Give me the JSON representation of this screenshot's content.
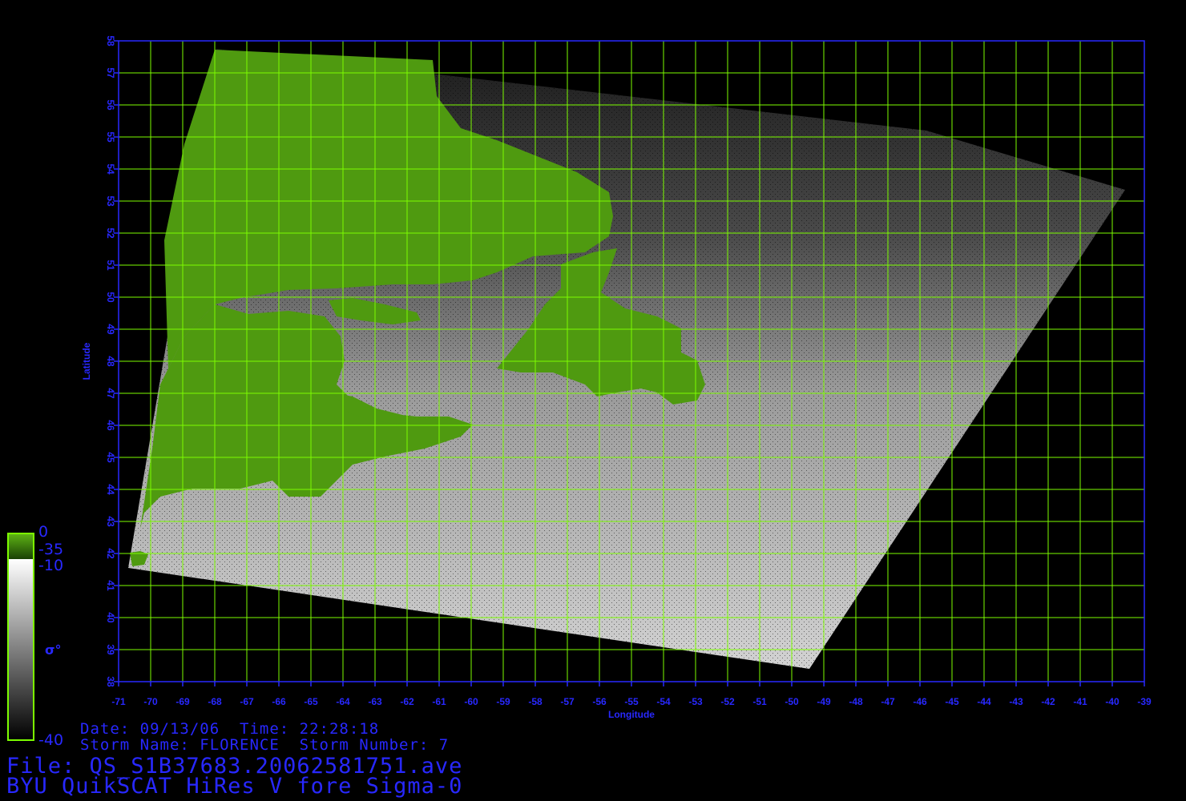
{
  "colors": {
    "axis": "#2828ff",
    "grid": "#7cfc00",
    "land": "#4f9a10",
    "text": "#2828ff",
    "background": "#000000"
  },
  "map": {
    "x_axis": {
      "label": "Longitude",
      "min": -71,
      "max": -39,
      "ticks": [
        -71,
        -70,
        -69,
        -68,
        -67,
        -66,
        -65,
        -64,
        -63,
        -62,
        -61,
        -60,
        -59,
        -58,
        -57,
        -56,
        -55,
        -54,
        -53,
        -52,
        -51,
        -50,
        -49,
        -48,
        -47,
        -46,
        -45,
        -44,
        -43,
        -42,
        -41,
        -40,
        -39
      ]
    },
    "y_axis": {
      "label": "Latitude",
      "min": 38,
      "max": 58,
      "ticks": [
        38,
        39,
        40,
        41,
        42,
        43,
        44,
        45,
        46,
        47,
        48,
        49,
        50,
        51,
        52,
        53,
        54,
        55,
        56,
        57,
        58
      ]
    },
    "swath_corners_lonlat": [
      [
        -67.95,
        57.75
      ],
      [
        -45.8,
        55.2
      ],
      [
        -39.6,
        53.35
      ],
      [
        -49.45,
        38.4
      ],
      [
        -70.7,
        41.55
      ]
    ],
    "grid": true
  },
  "colorbar": {
    "land_top": "0",
    "land_bottom": "-35",
    "ocean_top": "-10",
    "ocean_bottom": "-40",
    "symbol": "σ°"
  },
  "info": {
    "date_line": "Date: 09/13/06  Time: 22:28:18",
    "storm_line": "Storm Name: FLORENCE  Storm Number: 7",
    "file_line": "File: QS_S1B37683.20062581751.ave",
    "title_line": "BYU QuikSCAT HiRes V fore Sigma-0"
  }
}
